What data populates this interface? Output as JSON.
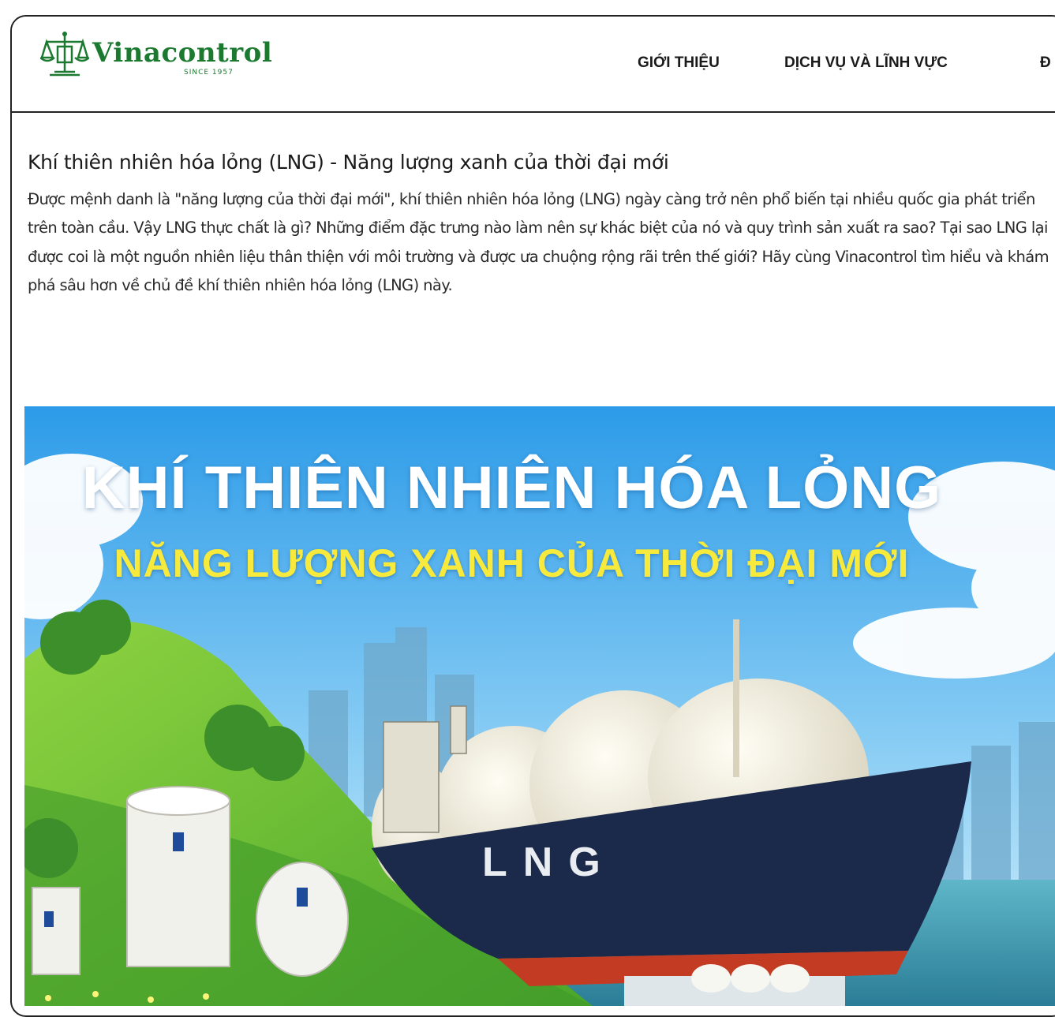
{
  "header": {
    "logo": {
      "name": "Vinacontrol",
      "tagline": "SINCE 1957"
    },
    "nav": [
      {
        "label": "GIỚI THIỆU"
      },
      {
        "label": "DỊCH VỤ VÀ LĨNH VỰC"
      },
      {
        "label": "Đ"
      }
    ]
  },
  "article": {
    "title": "Khí thiên nhiên hóa lỏng (LNG) - Năng lượng xanh của thời đại mới",
    "intro": "Được mệnh danh là \"năng lượng của thời đại mới\", khí thiên nhiên hóa lỏng (LNG) ngày càng trở nên phổ biến tại nhiều quốc gia phát triển trên toàn cầu. Vậy LNG thực chất là gì? Những điểm đặc trưng nào làm nên sự khác biệt của nó và quy trình sản xuất ra sao? Tại sao LNG lại được coi là một nguồn nhiên liệu thân thiện với môi trường và được ưa chuộng rộng rãi trên thế giới? Hãy cùng Vinacontrol tìm hiểu và khám phá sâu hơn về chủ đề khí thiên nhiên hóa lỏng (LNG) này."
  },
  "hero": {
    "title_line1": "KHÍ THIÊN NHIÊN HÓA LỎNG",
    "title_line2": "NĂNG LƯỢNG XANH CỦA THỜI ĐẠI MỚI",
    "ship_text": "LNG"
  },
  "colors": {
    "brand_green": "#1c7a30",
    "hero_title_white": "#ffffff",
    "hero_title_yellow": "#f7ea3c",
    "ship_hull": "#1b2a4a"
  }
}
